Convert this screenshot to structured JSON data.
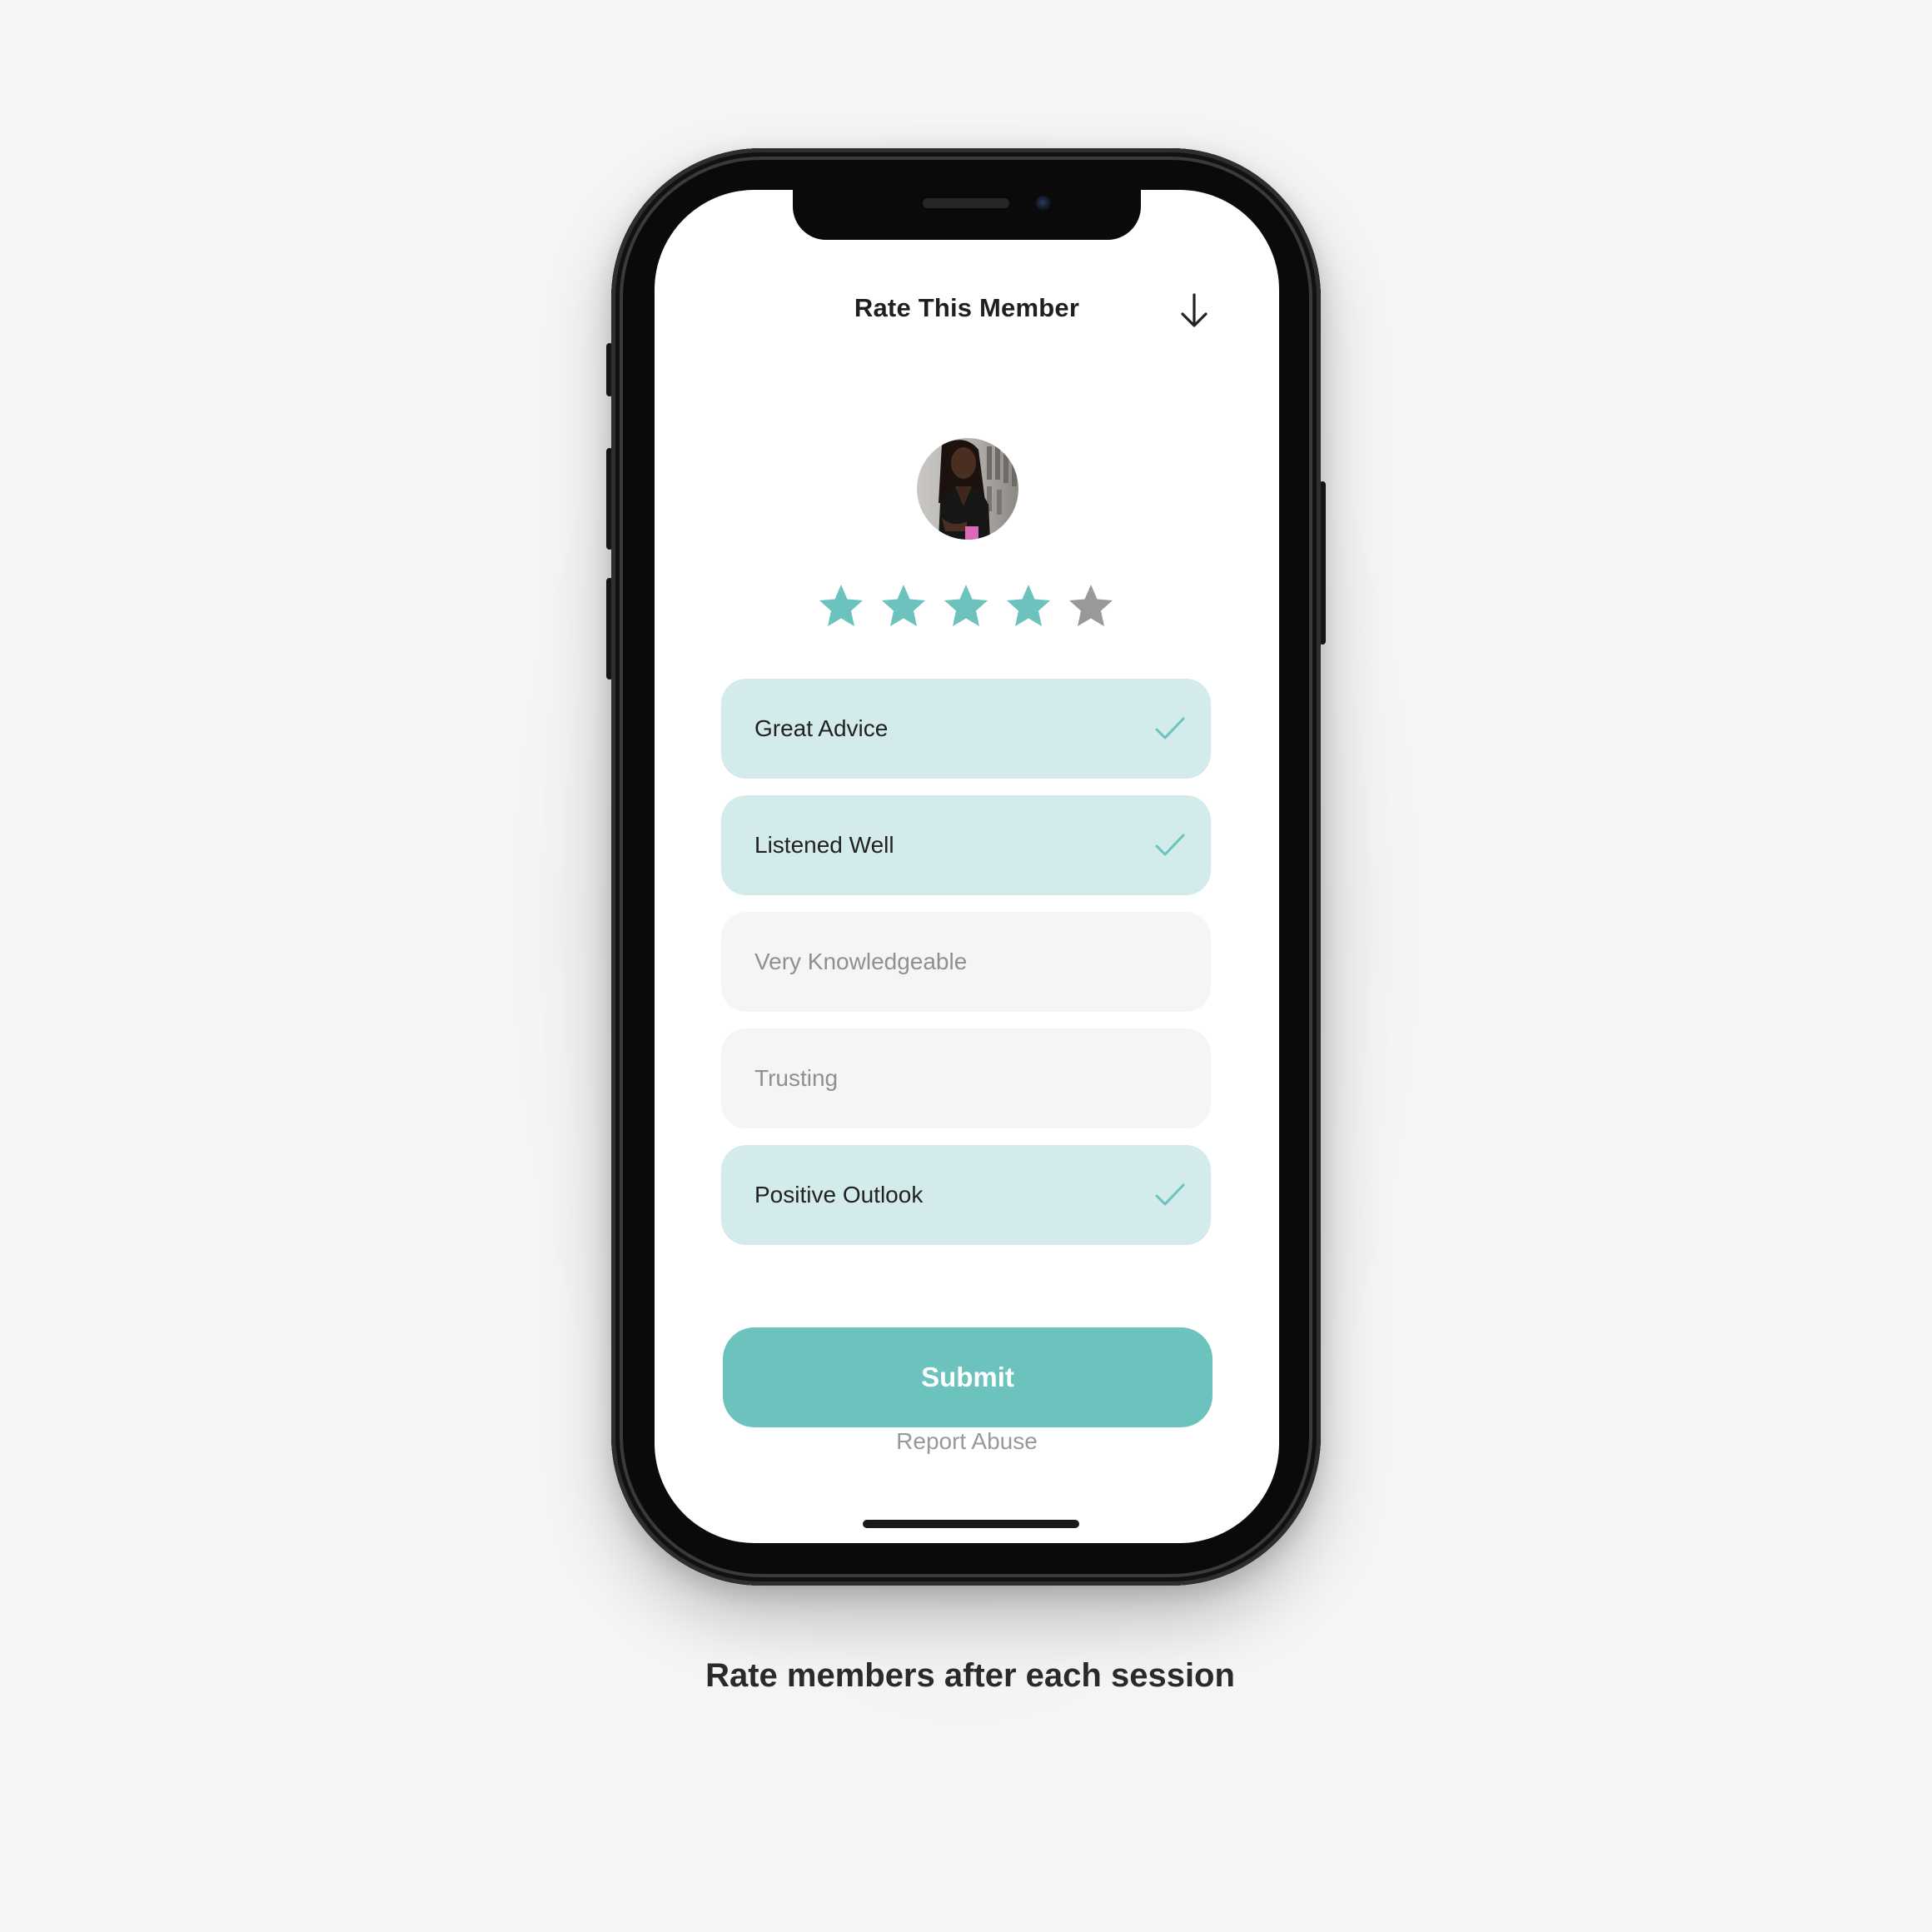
{
  "screen": {
    "title": "Rate This Member",
    "close_icon": "arrow-down-icon",
    "avatar_icon": "member-avatar-photo"
  },
  "rating": {
    "value": 4,
    "max": 5,
    "active_color": "#6cc2bc",
    "inactive_color": "#999999"
  },
  "options": [
    {
      "label": "Great Advice",
      "selected": true
    },
    {
      "label": "Listened Well",
      "selected": true
    },
    {
      "label": "Very Knowledgeable",
      "selected": false
    },
    {
      "label": "Trusting",
      "selected": false
    },
    {
      "label": "Positive Outlook",
      "selected": true
    }
  ],
  "actions": {
    "submit_label": "Submit",
    "report_label": "Report Abuse"
  },
  "caption": "Rate members after each session",
  "colors": {
    "accent": "#6cc2bc",
    "selected_bg": "#d3ebea",
    "unselected_bg": "#f5f5f5"
  }
}
